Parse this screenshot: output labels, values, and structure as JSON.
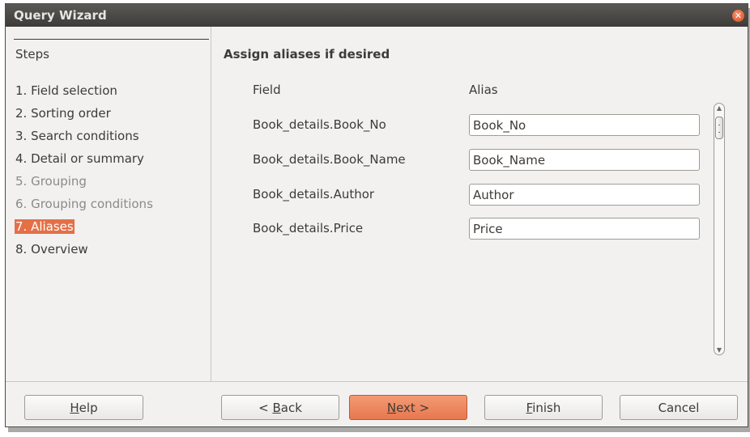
{
  "window": {
    "title": "Query Wizard"
  },
  "steps": {
    "heading": "Steps",
    "items": [
      {
        "label": "1. Field selection"
      },
      {
        "label": "2. Sorting order"
      },
      {
        "label": "3. Search conditions"
      },
      {
        "label": "4. Detail or summary"
      },
      {
        "label": "5. Grouping"
      },
      {
        "label": "6. Grouping conditions"
      },
      {
        "label": "7. Aliases"
      },
      {
        "label": "8. Overview"
      }
    ]
  },
  "content": {
    "heading": "Assign aliases if desired",
    "col_field": "Field",
    "col_alias": "Alias",
    "rows": [
      {
        "field": "Book_details.Book_No",
        "alias": "Book_No"
      },
      {
        "field": "Book_details.Book_Name",
        "alias": "Book_Name"
      },
      {
        "field": "Book_details.Author",
        "alias": "Author"
      },
      {
        "field": "Book_details.Price",
        "alias": "Price"
      }
    ]
  },
  "buttons": {
    "help_mnemonic": "H",
    "help_rest": "elp",
    "back_prefix": "< ",
    "back_mnemonic": "B",
    "back_rest": "ack",
    "next_mnemonic": "N",
    "next_rest": "ext >",
    "finish_mnemonic": "F",
    "finish_rest": "inish",
    "cancel": "Cancel"
  }
}
